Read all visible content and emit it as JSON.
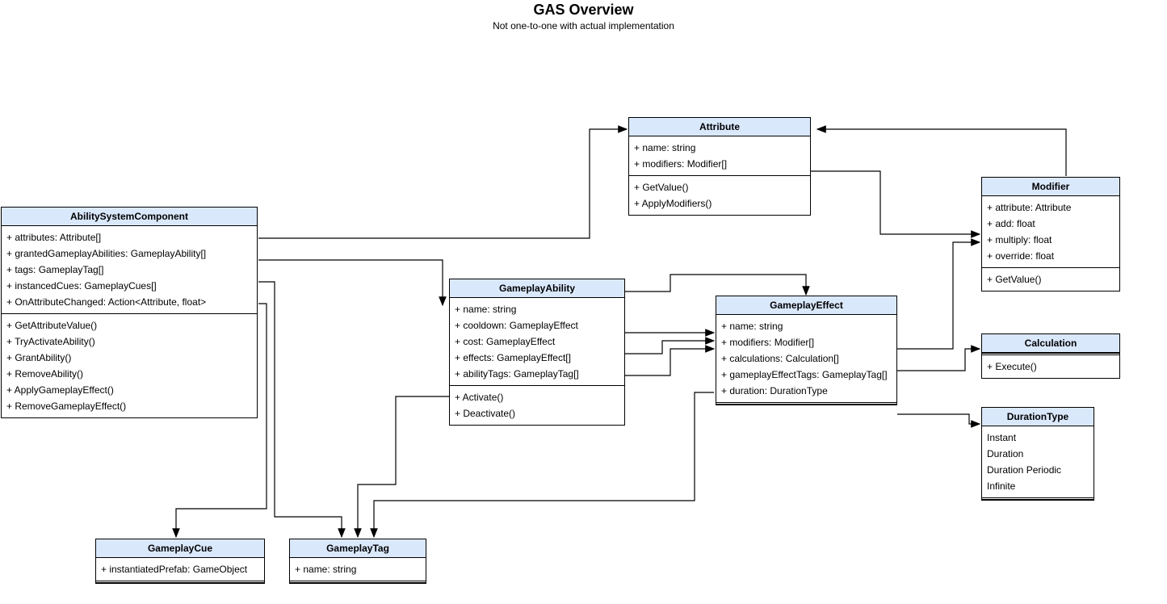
{
  "header": {
    "title": "GAS Overview",
    "subtitle": "Not one-to-one with actual implementation"
  },
  "classes": {
    "asc": {
      "name": "AbilitySystemComponent",
      "attributes": [
        "+ attributes: Attribute[]",
        "+ grantedGameplayAbilities: GameplayAbility[]",
        "+ tags: GameplayTag[]",
        "+ instancedCues: GameplayCues[]",
        "+ OnAttributeChanged: Action<Attribute, float>"
      ],
      "methods": [
        "+ GetAttributeValue()",
        "+ TryActivateAbility()",
        "+ GrantAbility()",
        "+ RemoveAbility()",
        "+ ApplyGameplayEffect()",
        "+ RemoveGameplayEffect()"
      ]
    },
    "attribute": {
      "name": "Attribute",
      "attributes": [
        "+ name: string",
        "+ modifiers: Modifier[]"
      ],
      "methods": [
        "+ GetValue()",
        "+ ApplyModifiers()"
      ]
    },
    "modifier": {
      "name": "Modifier",
      "attributes": [
        "+ attribute: Attribute",
        "+ add: float",
        "+ multiply: float",
        "+ override: float"
      ],
      "methods": [
        "+ GetValue()"
      ]
    },
    "gameplayAbility": {
      "name": "GameplayAbility",
      "attributes": [
        "+ name: string",
        "+ cooldown: GameplayEffect",
        "+ cost: GameplayEffect",
        "+ effects: GameplayEffect[]",
        "+ abilityTags: GameplayTag[]"
      ],
      "methods": [
        "+ Activate()",
        "+ Deactivate()"
      ]
    },
    "gameplayEffect": {
      "name": "GameplayEffect",
      "attributes": [
        "+ name: string",
        "+ modifiers: Modifier[]",
        "+ calculations: Calculation[]",
        "+ gameplayEffectTags: GameplayTag[]",
        "+ duration: DurationType"
      ]
    },
    "calculation": {
      "name": "Calculation",
      "methods": [
        "+ Execute()"
      ]
    },
    "durationType": {
      "name": "DurationType",
      "values": [
        "Instant",
        "Duration",
        "Duration Periodic",
        "Infinite"
      ]
    },
    "gameplayCue": {
      "name": "GameplayCue",
      "attributes": [
        "+ instantiatedPrefab: GameObject"
      ]
    },
    "gameplayTag": {
      "name": "GameplayTag",
      "attributes": [
        "+ name: string"
      ]
    }
  }
}
